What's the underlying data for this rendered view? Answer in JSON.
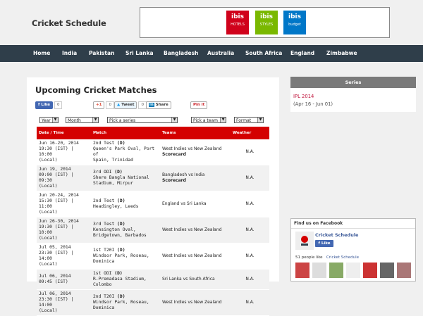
{
  "header": {
    "site_title": "Cricket Schedule",
    "ad_brands": [
      {
        "name": "ibis",
        "sub": "HOTELS",
        "color": "#d0021b"
      },
      {
        "name": "ibis",
        "sub": "STYLES",
        "color": "#7ab800"
      },
      {
        "name": "ibis",
        "sub": "budget",
        "color": "#0077c8"
      }
    ]
  },
  "nav": [
    "Home",
    "India",
    "Pakistan",
    "Sri Lanka",
    "Bangladesh",
    "Australia",
    "South Africa",
    "England",
    "Zimbabwe"
  ],
  "main": {
    "title": "Upcoming Cricket Matches",
    "social": {
      "like_label": "Like",
      "like_count": "0",
      "gplus_label": "+1",
      "gplus_count": "0",
      "tweet_label": "Tweet",
      "tweet_count": "0",
      "share_label": "Share",
      "pin_label": "Pin it"
    },
    "filters": {
      "year": "Year",
      "month": "Month",
      "series": "Pick a series",
      "team": "Pick a team",
      "format": "Format"
    },
    "table": {
      "headers": [
        "Date / Time",
        "Match",
        "Teams",
        "Weather"
      ],
      "rows": [
        {
          "date": [
            "Jun 16-20, 2014",
            "19:30 (IST) | 10:00",
            "(Local)"
          ],
          "match": "2nd Test",
          "fmt": "(D)",
          "venue": [
            "Queen's Park Oval, Port of",
            "Spain, Trinidad"
          ],
          "teams": "West Indies vs New Zealand",
          "scorecard": "Scorecard",
          "weather": "N.A."
        },
        {
          "date": [
            "Jun 19, 2014",
            "09:00 (IST) | 09:30",
            "(Local)"
          ],
          "match": "3rd ODI",
          "fmt": "(D)",
          "venue": [
            "Shere Bangla National",
            "Stadium, Mirpur"
          ],
          "teams": "Bangladesh vs India",
          "scorecard": "Scorecard",
          "weather": "N.A."
        },
        {
          "date": [
            "Jun 20-24, 2014",
            "15:30 (IST) | 11:00",
            "(Local)"
          ],
          "match": "2nd Test",
          "fmt": "(D)",
          "venue": [
            "Headingley, Leeds"
          ],
          "teams": "England vs Sri Lanka",
          "scorecard": "",
          "weather": "N.A."
        },
        {
          "date": [
            "Jun 26-30, 2014",
            "19:30 (IST) | 10:00",
            "(Local)"
          ],
          "match": "3rd Test",
          "fmt": "(D)",
          "venue": [
            "Kensington Oval,",
            "Bridgetown, Barbados"
          ],
          "teams": "West Indies vs New Zealand",
          "scorecard": "",
          "weather": "N.A."
        },
        {
          "date": [
            "Jul 05, 2014",
            "23:30 (IST) | 14:00",
            "(Local)"
          ],
          "match": "1st T20I",
          "fmt": "(D)",
          "venue": [
            "Windsor Park, Roseau,",
            "Dominica"
          ],
          "teams": "West Indies vs New Zealand",
          "scorecard": "",
          "weather": "N.A."
        },
        {
          "date": [
            "Jul 06, 2014",
            "09:45 (IST)"
          ],
          "match": "1st ODI",
          "fmt": "(D)",
          "venue": [
            "R.Premadasa Stadium,",
            "Colombo"
          ],
          "teams": "Sri Lanka vs South Africa",
          "scorecard": "",
          "weather": "N.A."
        },
        {
          "date": [
            "Jul 06, 2014",
            "23:30 (IST) | 14:00",
            "(Local)"
          ],
          "match": "2nd T20I",
          "fmt": "(D)",
          "venue": [
            "Windsor Park, Roseau,",
            "Dominica"
          ],
          "teams": "West Indies vs New Zealand",
          "scorecard": "",
          "weather": "N.A."
        }
      ]
    }
  },
  "sidebar": {
    "series_heading": "Series",
    "series_link": "IPL 2014",
    "series_dates": "(Apr 16 - Jun 01)",
    "fb_heading": "Find us on Facebook",
    "fb_page": "Cricket Schedule",
    "fb_like": "Like",
    "fb_people": "51 people like",
    "fb_people_link": "Cricket Schedule"
  },
  "colors": {
    "nav_bg": "#2f3e4a",
    "table_header": "#d40000",
    "series_link": "#c0143c",
    "fb_blue": "#3b5998"
  }
}
